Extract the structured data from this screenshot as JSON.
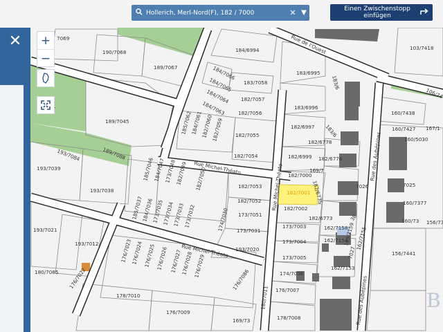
{
  "search": {
    "query": "Hollerich, Merl-Nord(F), 182 / 7000",
    "search_icon": "search-icon",
    "clear_icon": "close-icon",
    "dropdown_icon": "chevron-down-icon"
  },
  "add_stop_button": {
    "label": "Einen Zwischenstopp einfügen",
    "icon": "turn-right-arrow-icon"
  },
  "sidebar": {
    "close_icon": "close-icon"
  },
  "map_controls": {
    "zoom_in": "+",
    "zoom_out": "−",
    "region_icon": "luxembourg-outline-icon",
    "fullscreen_icon": "fullscreen-icon"
  },
  "colors": {
    "road": "#ffffff",
    "road_outline": "#2b2b2b",
    "parcel_fill": "#f2f2f2",
    "parcel_line": "#8a8a8a",
    "green_area": "#a6cf96",
    "building": "#666666",
    "selected_parcel": "#fff27a",
    "panel_blue": "#33659d",
    "button_dark": "#1e3f72"
  },
  "streets": [
    "Rue de l'Ouest",
    "Rue Michel-Théato",
    "Rue Michel-Théato",
    "Rue Michel-Théato",
    "Rue des Aubépines",
    "Rue des Aubépines"
  ],
  "parcels": [
    "7069",
    "190/7068",
    "189/7067",
    "184/6994",
    "103/7418",
    "106/74",
    "7087",
    "189/7045",
    "184/7066",
    "184/7065",
    "184/7064",
    "184/7063",
    "183/7058",
    "182/7057",
    "182/7056",
    "182/7055",
    "182/7054",
    "183/6995",
    "183/6996",
    "182/6997",
    "182/6778",
    "182/6999",
    "182/7000",
    "182/6775",
    "182/7001",
    "182/7002",
    "182/6773",
    "173/7003",
    "173/7004",
    "173/7005",
    "174/7006",
    "176/7007",
    "178/7008",
    "183/6",
    "183/6",
    "160/7438",
    "160/7427",
    "160/5030",
    "167/1",
    "185/7062",
    "184/7061",
    "182/7060",
    "182/7059",
    "193/7084",
    "189/7088",
    "193/7039",
    "193/7038",
    "185/7046",
    "184/7047",
    "173/7048",
    "182/7049",
    "182/7050",
    "182/7053",
    "182/7052",
    "173/7051",
    "173/7031",
    "185/7037",
    "184/7036",
    "173/7035",
    "173/7034",
    "173/7033",
    "173/7032",
    "174/7030",
    "193/7020",
    "193/7021",
    "193/7012",
    "180/7085",
    "176/7022",
    "176/7023",
    "176/7024",
    "176/7025",
    "176/7026",
    "176/7027",
    "176/7028",
    "176/7029",
    "176/7086",
    "180/7011",
    "178/7010",
    "176/7009",
    "169/73",
    "182/6776",
    "169/7",
    "162/7158",
    "162/7154",
    "162/7153",
    "169/7159",
    "162/7155",
    "38",
    "7027",
    "7026",
    "7025",
    "160/7377",
    "160/73",
    "156/7441",
    "156/7364"
  ],
  "selected_parcel": "182/7001"
}
